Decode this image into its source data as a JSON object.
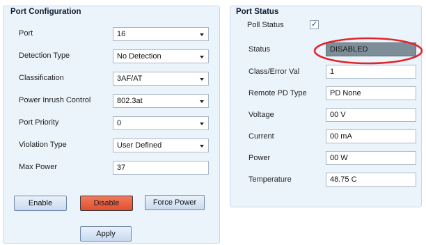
{
  "port_config": {
    "title": "Port Configuration",
    "rows": [
      {
        "label": "Port",
        "value": "16",
        "type": "combo"
      },
      {
        "label": "Detection Type",
        "value": "No Detection",
        "type": "combo"
      },
      {
        "label": "Classification",
        "value": "3AF/AT",
        "type": "combo"
      },
      {
        "label": "Power Inrush Control",
        "value": "802.3at",
        "type": "combo"
      },
      {
        "label": "Port Priority",
        "value": "0",
        "type": "combo"
      },
      {
        "label": "Violation Type",
        "value": "User Defined",
        "type": "combo"
      },
      {
        "label": "Max Power",
        "value": "37",
        "type": "text"
      }
    ],
    "buttons": {
      "enable": "Enable",
      "disable": "Disable",
      "force_power": "Force Power",
      "apply": "Apply"
    }
  },
  "port_status": {
    "title": "Port Status",
    "poll_status": {
      "label": "Poll Status",
      "checked": true,
      "tick": "✓"
    },
    "rows": [
      {
        "label": "Status",
        "value": "DISABLED"
      },
      {
        "label": "Class/Error Val",
        "value": "1"
      },
      {
        "label": "Remote PD Type",
        "value": "PD None"
      },
      {
        "label": "Voltage",
        "value": "00 V"
      },
      {
        "label": "Current",
        "value": "00 mA"
      },
      {
        "label": "Power",
        "value": "00 W"
      },
      {
        "label": "Temperature",
        "value": "48.75 C"
      }
    ]
  },
  "colors": {
    "panel_bg": "#ebf3fb",
    "disable_button": "#e8603f",
    "status_box": "#7e8e99",
    "highlight_ellipse": "#e0252a"
  }
}
